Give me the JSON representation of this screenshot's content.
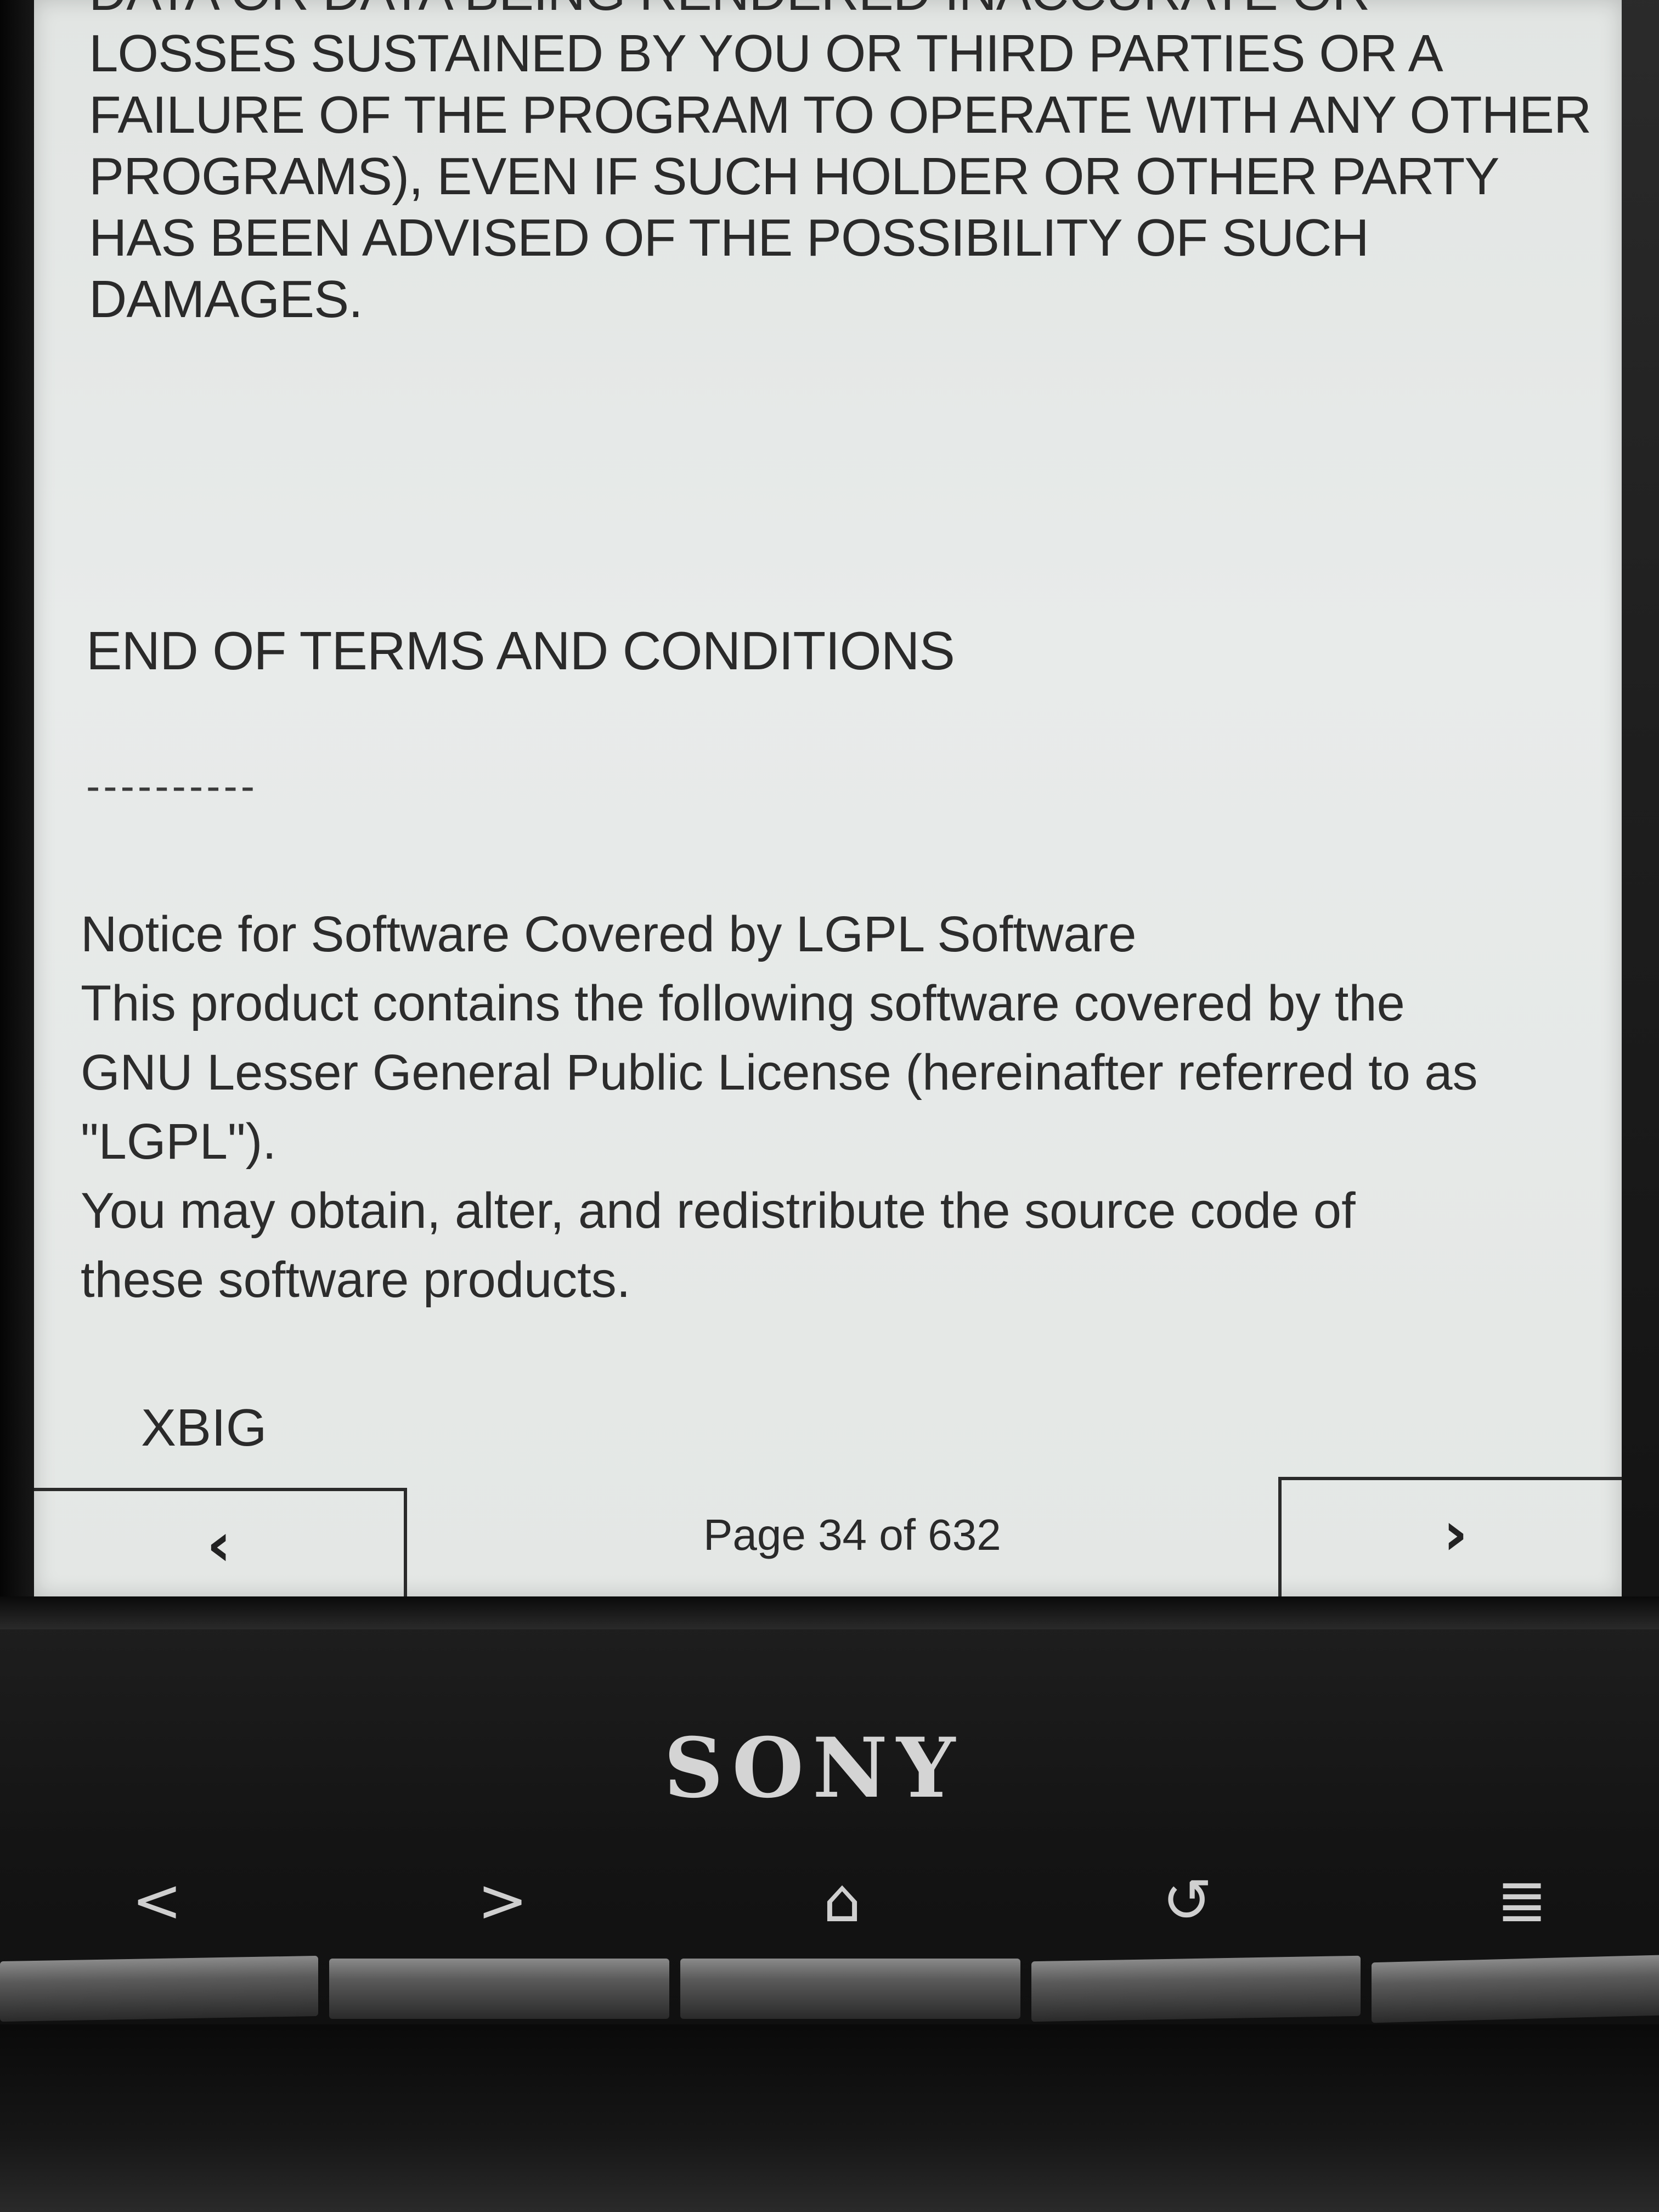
{
  "document": {
    "legal_lines": [
      "DATA OR DATA BEING RENDERED INACCURATE OR",
      "LOSSES SUSTAINED BY YOU OR THIRD PARTIES OR A",
      "FAILURE OF THE PROGRAM TO OPERATE WITH ANY OTHER",
      "PROGRAMS), EVEN IF SUCH HOLDER OR OTHER PARTY",
      "HAS BEEN ADVISED OF THE POSSIBILITY OF SUCH",
      "DAMAGES."
    ],
    "end_of_terms": "END OF TERMS AND CONDITIONS",
    "divider": "----------",
    "notice_lines": [
      "Notice for Software Covered by LGPL Software",
      "This product contains the following software covered by the",
      "GNU Lesser General Public License (hereinafter referred to as",
      "\"LGPL\").",
      "You may obtain, alter, and redistribute the source code of",
      "these software products."
    ],
    "software_item": "XBIG"
  },
  "reader_nav": {
    "prev_icon": "chevron-left-icon",
    "next_icon": "chevron-right-icon",
    "prev_glyph": "‹",
    "next_glyph": "›",
    "page_label": "Page 34 of 632"
  },
  "device": {
    "brand": "SONY",
    "buttons": [
      {
        "name": "back-arrow-icon",
        "glyph": "<"
      },
      {
        "name": "forward-arrow-icon",
        "glyph": ">"
      },
      {
        "name": "home-icon",
        "glyph": "⌂"
      },
      {
        "name": "return-icon",
        "glyph": "↺"
      },
      {
        "name": "menu-icon",
        "glyph": "≣"
      }
    ]
  }
}
